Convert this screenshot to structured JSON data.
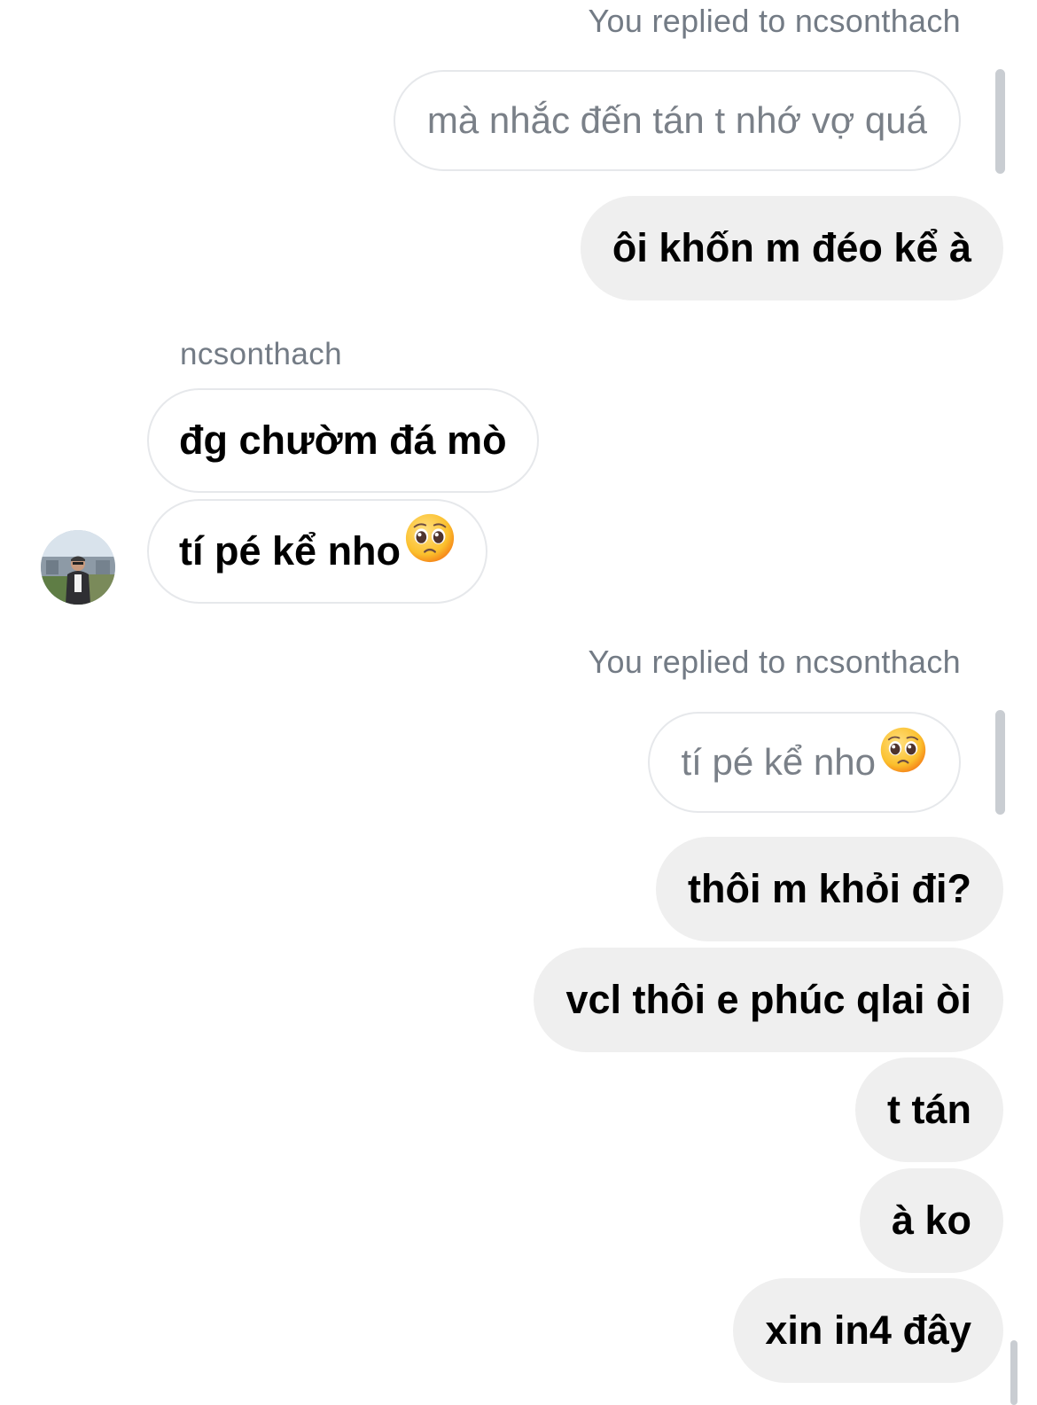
{
  "thread": {
    "partner_username": "ncsonthach",
    "messages": [
      {
        "kind": "reply-header",
        "text": "You replied to ncsonthach"
      },
      {
        "kind": "quoted",
        "text": "mà nhắc đến tán t nhớ vợ quá"
      },
      {
        "kind": "outgoing",
        "text": "ôi khốn m đéo kể à"
      },
      {
        "kind": "sender-name",
        "text": "ncsonthach"
      },
      {
        "kind": "incoming",
        "text": "đg chườm đá mò"
      },
      {
        "kind": "incoming",
        "text": "tí pé kể nho",
        "emoji": "pleading-face-emoji"
      },
      {
        "kind": "reply-header",
        "text": "You replied to ncsonthach"
      },
      {
        "kind": "quoted",
        "text": "tí pé kể nho",
        "emoji": "pleading-face-emoji"
      },
      {
        "kind": "outgoing",
        "text": "thôi m khỏi đi?"
      },
      {
        "kind": "outgoing",
        "text": "vcl thôi e phúc qlai òi"
      },
      {
        "kind": "outgoing",
        "text": "t tán"
      },
      {
        "kind": "outgoing",
        "text": "à ko"
      },
      {
        "kind": "outgoing",
        "text": "xin in4 đây"
      }
    ]
  },
  "colors": {
    "outgoing_bubble": "#efefef",
    "incoming_bubble_border": "#e6e8eb",
    "meta_text": "#737b85",
    "quote_bar": "#c9cdd2",
    "emoji_face": "#fbc02d"
  },
  "icons": {
    "avatar": "avatar",
    "emoji": "pleading-face-emoji"
  }
}
